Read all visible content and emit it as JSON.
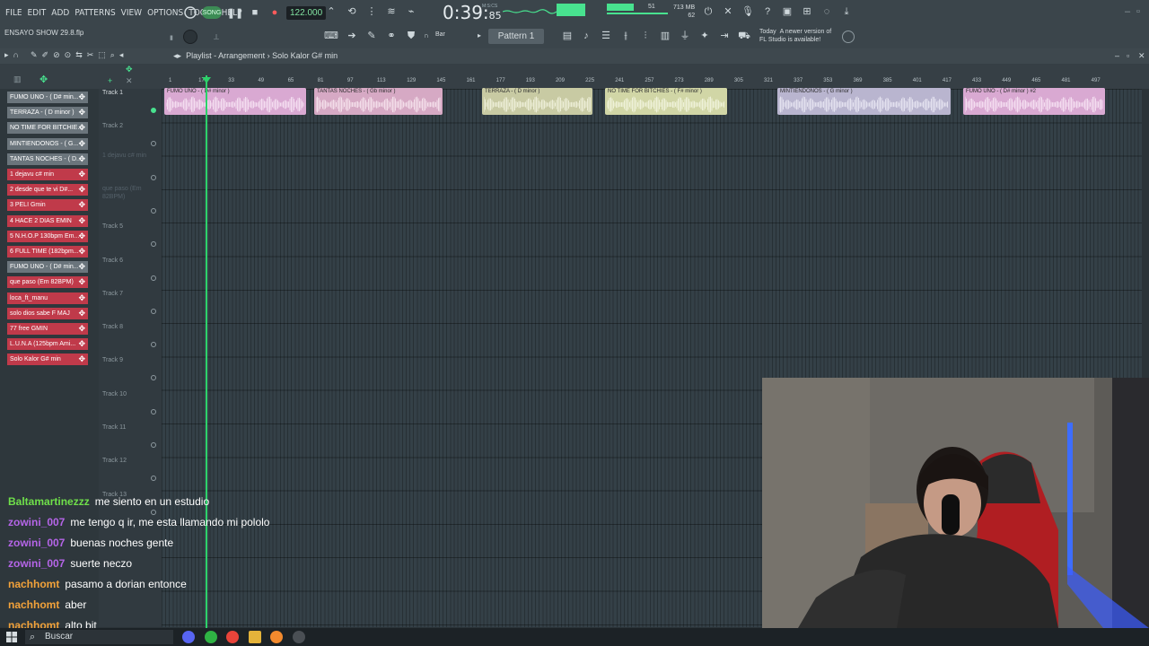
{
  "menubar": {
    "items": [
      "FILE",
      "EDIT",
      "ADD",
      "PATTERNS",
      "VIEW",
      "OPTIONS",
      "TOOLS",
      "HELP"
    ],
    "song_label": "SONG",
    "tempo": "122.000",
    "time_main": "0:39:",
    "time_frac": "85",
    "time_unit": "M:S:CS",
    "memory": "713 MB",
    "cpu": "62",
    "voices": "51"
  },
  "project": {
    "name": "ENSAYO SHOW 29.8.flp"
  },
  "toolbar": {
    "snap": "Bar",
    "pattern": "Pattern 1",
    "news_line1": "A newer version of",
    "news_line2": "FL Studio is available!",
    "news_prefix": "Today"
  },
  "playlist": {
    "title": "Playlist - Arrangement",
    "separator": "›",
    "current": "Solo Kalor G# min",
    "timeline_ticks": [
      "1",
      "17",
      "33",
      "49",
      "65",
      "81",
      "97",
      "113",
      "129",
      "145",
      "161",
      "177",
      "193",
      "209",
      "225",
      "241",
      "257",
      "273",
      "289",
      "305",
      "321",
      "337",
      "353",
      "369",
      "385",
      "401",
      "417",
      "433",
      "449",
      "465",
      "481",
      "497"
    ],
    "tracks": [
      "Track 1",
      "Track 2",
      "",
      "",
      "Track 5",
      "Track 6",
      "Track 7",
      "Track 8",
      "Track 9",
      "Track 10",
      "Track 11",
      "Track 12",
      "Track 13"
    ],
    "ghost_labels": [
      "1 dejavu c# min",
      "que paso (Em 82BPM)"
    ],
    "clips": [
      {
        "name": "FUMO UNO - ( D# minor )",
        "color": "#d9a9d2",
        "wave": "#f4ddf0"
      },
      {
        "name": "TANTAS NOCHES - ( Gb minor )",
        "color": "#d6a9c4",
        "wave": "#f3dde9"
      },
      {
        "name": "TERRAZA - ( D minor )",
        "color": "#c8caa3",
        "wave": "#ecedd6"
      },
      {
        "name": "NO TIME FOR BITCHIES - ( F# minor )",
        "color": "#d1d6a6",
        "wave": "#eef1d8"
      },
      {
        "name": "MINTIENDONOS - ( G minor )",
        "color": "#b9b5cf",
        "wave": "#e3e1ef"
      },
      {
        "name": "FUMO UNO - ( D# minor ) #2",
        "color": "#d9a9d2",
        "wave": "#f4ddf0"
      }
    ]
  },
  "picker": {
    "items": [
      {
        "label": "FUMO UNO - ( D# min...",
        "kind": "grey"
      },
      {
        "label": "TERRAZA - ( D minor )",
        "kind": "grey"
      },
      {
        "label": "NO TIME FOR BITCHIE...",
        "kind": "grey"
      },
      {
        "label": "MINTIENDONOS - ( G...",
        "kind": "grey"
      },
      {
        "label": "TANTAS NOCHES - ( D...",
        "kind": "grey"
      },
      {
        "label": "1 dejavu c# min",
        "kind": "red"
      },
      {
        "label": "2 desde que te vi D#...",
        "kind": "red"
      },
      {
        "label": "3 PELI Gmin",
        "kind": "red"
      },
      {
        "label": "4 HACE 2 DIAS EMIN",
        "kind": "red"
      },
      {
        "label": "5 N.H.O.P 130bpm Em...",
        "kind": "red"
      },
      {
        "label": "6 FULL TIME (182bpm...",
        "kind": "red"
      },
      {
        "label": "FUMO UNO - ( D# min...",
        "kind": "grey"
      },
      {
        "label": "que paso (Em 82BPM)",
        "kind": "red"
      },
      {
        "label": "loca_ft_manu",
        "kind": "red"
      },
      {
        "label": "solo dios sabe F MAJ",
        "kind": "red"
      },
      {
        "label": "77 free GMIN",
        "kind": "red"
      },
      {
        "label": "L.U.N.A (125bpm Ami...",
        "kind": "red"
      },
      {
        "label": "Solo Kalor G# min",
        "kind": "red"
      }
    ],
    "colors": {
      "red": "#c03a4a",
      "grey": "#6b757c"
    }
  },
  "chat": [
    {
      "user": "Baltamartinezzz",
      "color": "#6fe04a",
      "msg": "me siento en un estudio"
    },
    {
      "user": "zowini_007",
      "color": "#b565e8",
      "msg": "me tengo q ir, me esta llamando mi pololo"
    },
    {
      "user": "zowini_007",
      "color": "#b565e8",
      "msg": "buenas noches gente"
    },
    {
      "user": "zowini_007",
      "color": "#b565e8",
      "msg": "suerte neczo"
    },
    {
      "user": "nachhomt",
      "color": "#f2a23a",
      "msg": "pasamo a dorian entonce"
    },
    {
      "user": "nachhomt",
      "color": "#f2a23a",
      "msg": "aber"
    },
    {
      "user": "nachhomt",
      "color": "#f2a23a",
      "msg": "alto bit"
    }
  ],
  "taskbar": {
    "search_placeholder": "Buscar"
  },
  "accent": "#2dd16a"
}
